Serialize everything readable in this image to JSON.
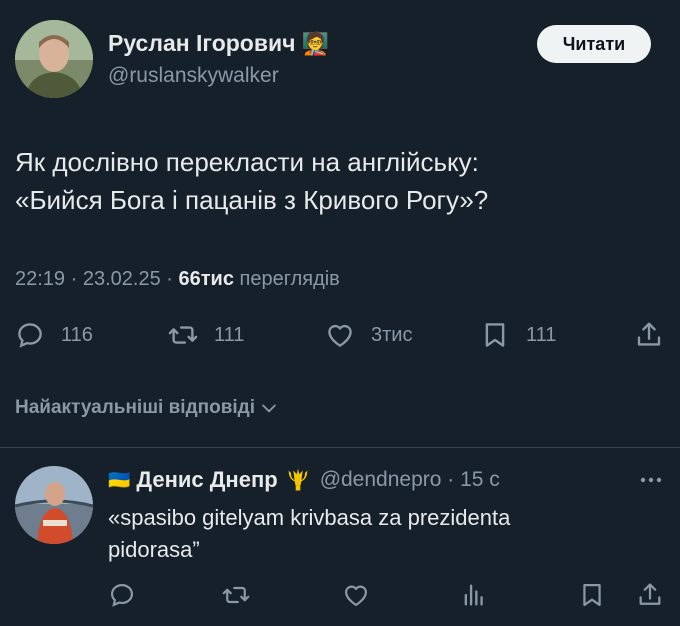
{
  "tweet": {
    "author_name": "Руслан Ігорович",
    "author_emoji": "🧑‍🏫",
    "handle": "@ruslanskywalker",
    "follow_label": "Читати",
    "text_line1": "Як дослівно перекласти на англійську:",
    "text_line2": "«Бийся Бога і пацанів з Кривого Рогу»?",
    "time": "22:19",
    "date": "23.02.25",
    "views_count": "66тис",
    "views_label": "переглядів",
    "replies": "116",
    "reposts": "111",
    "likes": "3тис",
    "bookmarks": "111"
  },
  "replies_sort_label": "Найактуальніші відповіді",
  "reply": {
    "flag": "🇺🇦",
    "author_name": "Денис Днепр",
    "emblem": "trident-icon",
    "handle": "@dendnepro",
    "time": "15 с",
    "text_line1": "«spasibo gitelyam krivbasa za prezidenta",
    "text_line2": "pidorasa”"
  },
  "colors": {
    "background": "#15202b",
    "text": "#e7e9ea",
    "secondary": "#8b98a5",
    "divider": "#38444d",
    "trident": "#f5c400"
  }
}
